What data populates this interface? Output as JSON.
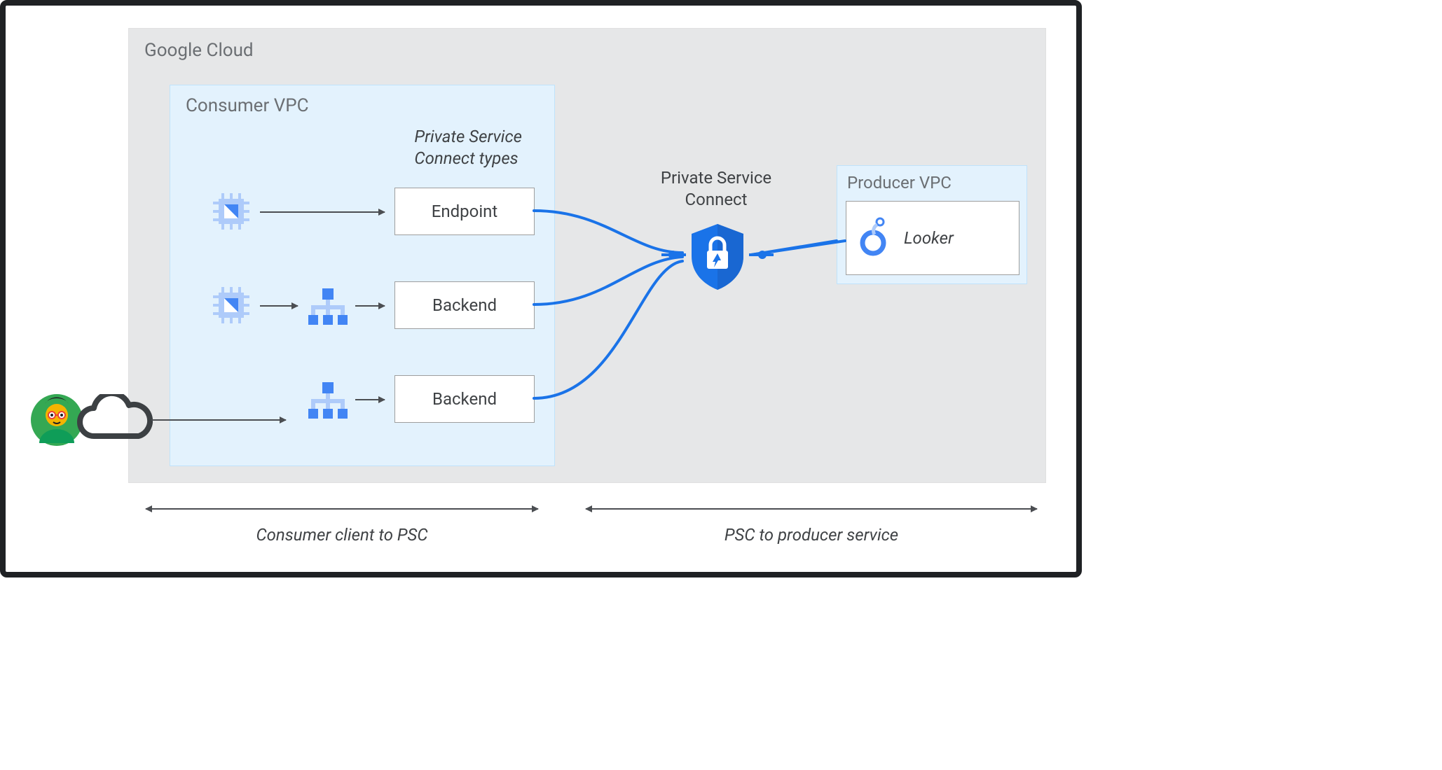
{
  "outer": {
    "title": "Google Cloud"
  },
  "consumer_vpc": {
    "title": "Consumer VPC",
    "psc_types_heading_line1": "Private Service",
    "psc_types_heading_line2": "Connect types",
    "endpoint_label": "Endpoint",
    "backend1_label": "Backend",
    "backend2_label": "Backend"
  },
  "psc": {
    "label_line1": "Private Service",
    "label_line2": "Connect"
  },
  "producer_vpc": {
    "title": "Producer VPC",
    "looker_label": "Looker"
  },
  "spans": {
    "consumer_to_psc": "Consumer client to PSC",
    "psc_to_producer": "PSC to producer service"
  },
  "icons": {
    "cpu": "cpu-icon",
    "lb": "load-balancer-icon",
    "shield": "psc-shield-icon",
    "user": "user-avatar-icon",
    "cloud": "cloud-icon",
    "looker": "looker-icon"
  },
  "colors": {
    "gcloud_bg": "#e6e7e8",
    "vpc_bg": "#e3f2fd",
    "wire_blue": "#1a73e8",
    "shield_blue": "#1a73e8",
    "text_gray": "#6b6f73",
    "arrow_gray": "#4b4e52"
  }
}
